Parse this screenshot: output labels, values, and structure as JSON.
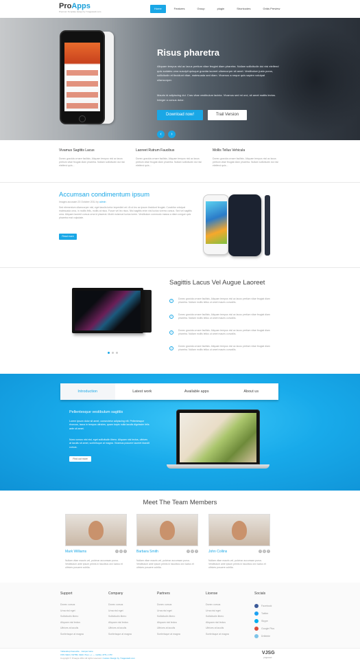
{
  "header": {
    "logo_pro": "Pro",
    "logo_apps": "Apps",
    "tagline": "Premium Template design by Ycagesweb.com",
    "nav": [
      "Home",
      "Features",
      "Group",
      "plugin",
      "Shortcodes",
      "Grids Preview"
    ]
  },
  "hero": {
    "title": "Risus pharetra",
    "text1": "Aliquam tempus nisl ac lacus pretium vitae feugiat diam pharetra. Nullam sollicitudin dui nisi eleifend quis sodales urna suscipit quisque gravida laoreet ullamcorper sit amet. Vestibulum justo purus, sollicitudin et tincidunt vitae, malesuada sed diam. Vivamus a neque quis sapien volutpat ullamcorper.",
    "text2": "Mauris id adipiscing dui. Cras vitae vestibulum lacinia. Vivamus sed mi orci, sit amet mattis lectus. Integer a cursus dolor.",
    "download": "Download now!",
    "trail": "Trail Version",
    "prev": "‹",
    "next": "›"
  },
  "features3": [
    {
      "title": "Vivamus Sagittis Lacus",
      "text": "Donec gravida ornare facilisis. Aliquam tempus nisl ac lacus pretium vitae feugiat diam pharetra. Nullam sollicitudin dui nisi eleifend quis..."
    },
    {
      "title": "Laoreet Rutrum Faucibus",
      "text": "Donec gravida ornare facilisis. Aliquam tempus nisl ac lacus pretium vitae feugiat diam pharetra. Nullam sollicitudin dui nisi eleifend quis..."
    },
    {
      "title": "Mollis Tellus Vehicula",
      "text": "Donec gravida ornare facilisis. Aliquam tempus nisl ac lacus pretium vitae feugiat diam pharetra. Nullam sollicitudin dui nisi eleifend quis..."
    }
  ],
  "article": {
    "title": "Accumsan condimentum ipsum",
    "meta": "Images accusam  23 October 2011  by ",
    "author": "admin",
    "text": "Sed elementum ullamcorper nisl, eget iaculis tortor imperdiet vel. At ut leo ac ipsum tincidunt feugiat. Curabitur volutpat malesuada urna, in mollis felis, mollis at risus. Fusce vel leo risus. Nisi sagittis enim nisl luctus viverra cursus. Sed vel sagittis urna. Aliquam laoreet cursus urna id placerat. Morbi euismod luctus lorem. Vestibulum commodo massa a diam congue quis pharetra erat vulputate.",
    "readmore": "Read more"
  },
  "features_list": {
    "title": "Sagittis Lacus Vel Augue Laoreet",
    "items": [
      "Donec gravida ornare facilisis. Aliquam tempus nisl ac lacus pretium vitae feugiat diam pharetra. Nullam mollis tellus ut amet mauris convallis.",
      "Donec gravida ornare facilisis. Aliquam tempus nisl ac lacus pretium vitae feugiat diam pharetra. Nullam mollis tellus ut amet mauris convallis.",
      "Donec gravida ornare facilisis. Aliquam tempus nisl ac lacus pretium vitae feugiat diam pharetra. Nullam mollis tellus ut amet mauris convallis.",
      "Donec gravida ornare facilisis. Aliquam tempus nisl ac lacus pretium vitae feugiat diam pharetra. Nullam mollis tellus ut amet mauris convallis."
    ]
  },
  "tabs": {
    "items": [
      "Introduction",
      "Latest work",
      "Available apps",
      "About us"
    ],
    "heading": "Pellentesque vestibulum sagittis",
    "p1": "Lorem ipsum dolor sit amet, consectetur adipiscing elit. Pellentesque rhoncus, lacus in tempus ultricies, quam turpis nulla iaculis dignissim felis ante sit amet.",
    "p2": "Nunc cursus nisi nisl, eget sollicitudin libero. Aliquam nisl lectus, ultrices at iaculis sit amet, scelerisque at magna. Vivamus posuere laoreet blandit cursus.",
    "button": "Find out more"
  },
  "team": {
    "title": "Meet The Team Members",
    "members": [
      {
        "name": "Mark Williams",
        "text": "Nullam vitae mauris vel, pulvinar accumsan purus. Vestibulum ante ipsum primis in faucibus orci luctus et ultrices posuere cubilia."
      },
      {
        "name": "Barbara Smith",
        "text": "Nullam vitae mauris vel, pulvinar accumsan purus. Vestibulum ante ipsum primis in faucibus orci luctus et ultrices posuere cubilia."
      },
      {
        "name": "John Collins",
        "text": "Nullam vitae mauris vel, pulvinar accumsan purus. Vestibulum ante ipsum primis in faucibus orci luctus et ultrices posuere cubilia."
      }
    ]
  },
  "footer": {
    "cols": [
      {
        "title": "Support",
        "links": [
          "Donec cursus",
          "Urna nisl eget",
          "Sollicitudin libero",
          "Aliquam nisl lectus",
          "Ultrices at iaculis",
          "Scelerisque at magna"
        ]
      },
      {
        "title": "Company",
        "links": [
          "Donec cursus",
          "Urna nisl eget",
          "Sollicitudin libero",
          "Aliquam nisl lectus",
          "Ultrices at iaculis",
          "Scelerisque at magna"
        ]
      },
      {
        "title": "Partners",
        "links": [
          "Donec cursus",
          "Urna nisl eget",
          "Sollicitudin libero",
          "Aliquam nisl lectus",
          "Ultrices at iaculis",
          "Scelerisque at magna"
        ]
      },
      {
        "title": "License",
        "links": [
          "Donec cursus",
          "Urna nisl eget",
          "Sollicitudin libero",
          "Aliquam nisl lectus",
          "Ultrices at iaculis",
          "Scelerisque at magna"
        ]
      }
    ],
    "social_title": "Socials",
    "socials": [
      {
        "label": "Facebook",
        "color": "#3b5998"
      },
      {
        "label": "Twitter",
        "color": "#1da1f2"
      },
      {
        "label": "Skype",
        "color": "#00aff0"
      },
      {
        "label": "Google Plus",
        "color": "#dd4b39"
      },
      {
        "label": "Dribbble",
        "color": "#7fc4e8"
      }
    ],
    "bottom1": "YoDesktop Favourite · Jumper Here",
    "bottom2": "CSS Valid | XHTML Valid | Top | + | — mobile | RTL | LTR",
    "bottom3": "Copyright © Proapps 2011 All rights reserved. ",
    "bottom3_link": "Custom Design by Ycagesweb.com",
    "brand": "VJSG",
    "brand_sub": "ycagesweb"
  }
}
